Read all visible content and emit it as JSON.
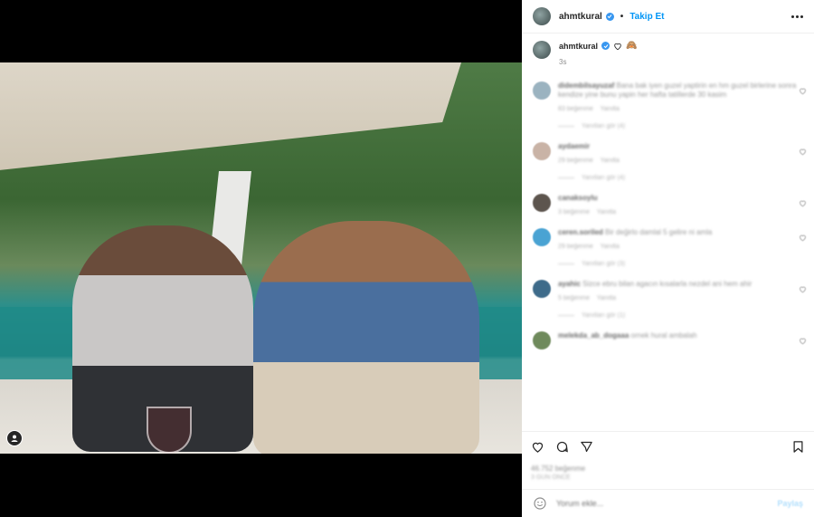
{
  "post": {
    "username": "ahmtkural",
    "follow_label": "Takip Et",
    "caption_emoji": "🙈",
    "time_ago": "3s"
  },
  "comments": [
    {
      "username": "didembilsayuzaf",
      "text": "Bana bak iyen guzel yaptirin en hm guzel birlerine sonra kendize yine bunu yapin her hafta tatillerde 30 kasim",
      "meta1": "83 beğenme",
      "meta2": "Yanıtla",
      "replies": "Yanıtları gör (4)"
    },
    {
      "username": "aydaemir",
      "text": "",
      "meta1": "29 beğenme",
      "meta2": "Yanıtla",
      "replies": "Yanıtları gör (4)"
    },
    {
      "username": "canaksoylu",
      "text": "",
      "meta1": "3 beğenme",
      "meta2": "Yanıtla",
      "replies": ""
    },
    {
      "username": "ceren.soriled",
      "text": "Bir değirlo damlal 5 gelire ni amla",
      "meta1": "29 beğenme",
      "meta2": "Yanıtla",
      "replies": "Yanıtları gör (3)"
    },
    {
      "username": "ayahic",
      "text": "Sizce ebru bilan agacın kısalarla nezdel ani hem ahir",
      "meta1": "5 beğenme",
      "meta2": "Yanıtla",
      "replies": "Yanıtları gör (1)"
    },
    {
      "username": "melekda_ab_dogaaa",
      "text": "ornek hural ambalah",
      "meta1": "",
      "meta2": "",
      "replies": ""
    }
  ],
  "footer": {
    "likes_text": "46.752 beğenme",
    "date_text": "3 GÜN ÖNCE",
    "comment_placeholder": "Yorum ekle...",
    "post_label": "Paylaş"
  }
}
